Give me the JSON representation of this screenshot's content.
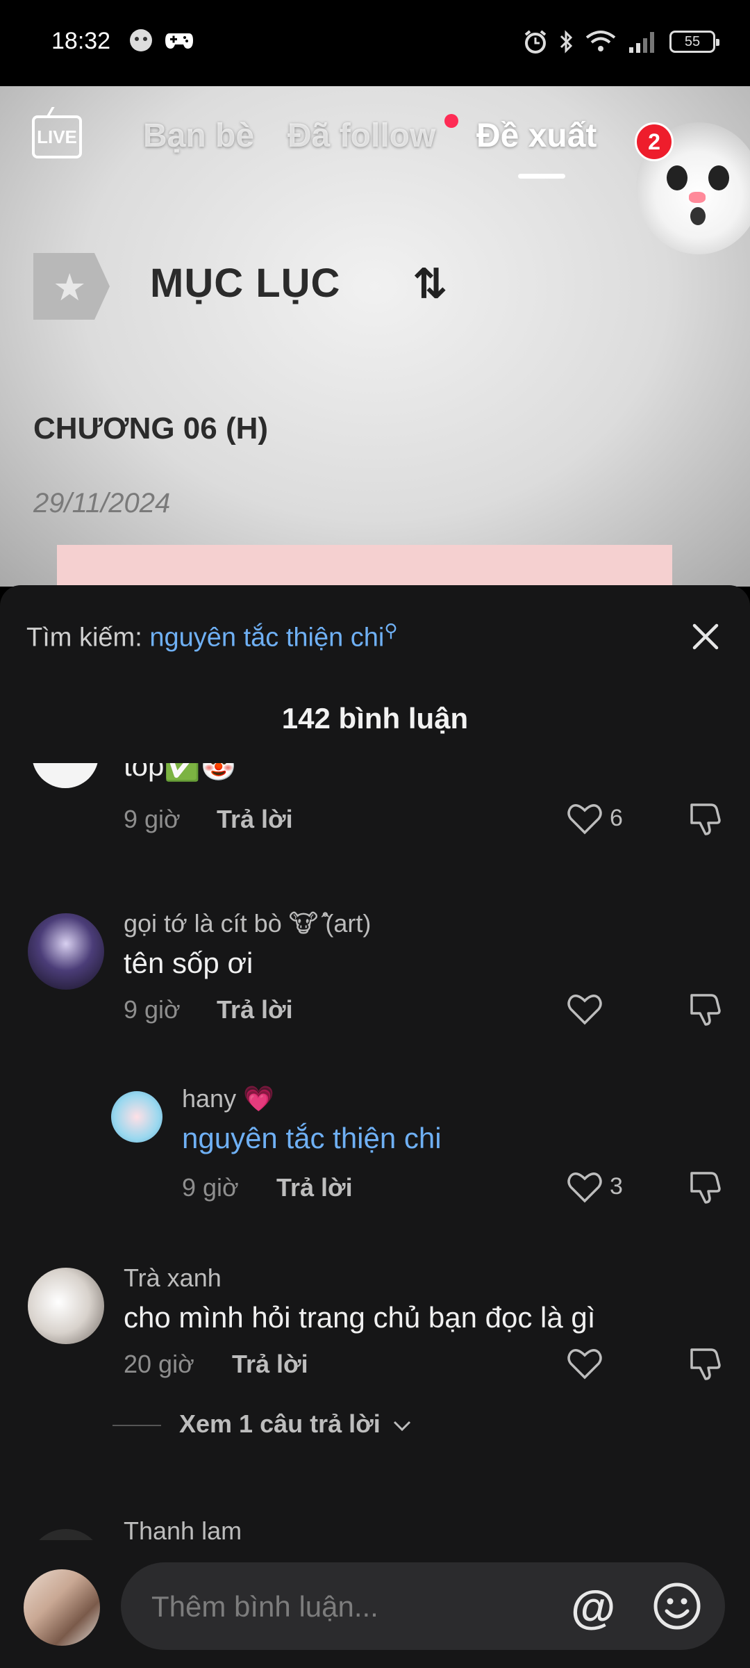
{
  "status_bar": {
    "time": "18:32",
    "battery": "55"
  },
  "top_nav": {
    "live_label": "LIVE",
    "tabs": [
      {
        "label": "Bạn bè"
      },
      {
        "label": "Đã follow"
      },
      {
        "label": "Đề xuất"
      }
    ],
    "notification_count": "2"
  },
  "video": {
    "toc_title": "MỤC LỤC",
    "chapter": "CHƯƠNG 06 (H)",
    "date": "29/11/2024"
  },
  "sheet": {
    "search_label": "Tìm kiếm:",
    "search_query": "nguyên tắc thiện chi",
    "comment_count": "142 bình luận",
    "comments": [
      {
        "text": "tóp✅🤡",
        "time": "9 giờ",
        "reply": "Trả lời",
        "likes": "6"
      },
      {
        "user": "gọi tớ là cít bò 🐮 ̊̂(art)",
        "text": "tên sốp ơi",
        "time": "9 giờ",
        "reply": "Trả lời",
        "likes": ""
      },
      {
        "user": "hany 💗",
        "text": "nguyên tắc thiện chi",
        "time": "9 giờ",
        "reply": "Trả lời",
        "likes": "3"
      },
      {
        "user": "Trà xanh",
        "text": "cho mình hỏi trang chủ bạn đọc là gì",
        "time": "20 giờ",
        "reply": "Trả lời",
        "likes": "",
        "view_replies": "Xem 1 câu trả lời"
      },
      {
        "user": "Thanh lam"
      }
    ]
  },
  "input": {
    "placeholder": "Thêm bình luận...",
    "at_symbol": "@"
  },
  "colors": {
    "accent_link": "#6fb0f4",
    "badge_red": "#ee1d2c",
    "sheet_bg": "#161617"
  }
}
